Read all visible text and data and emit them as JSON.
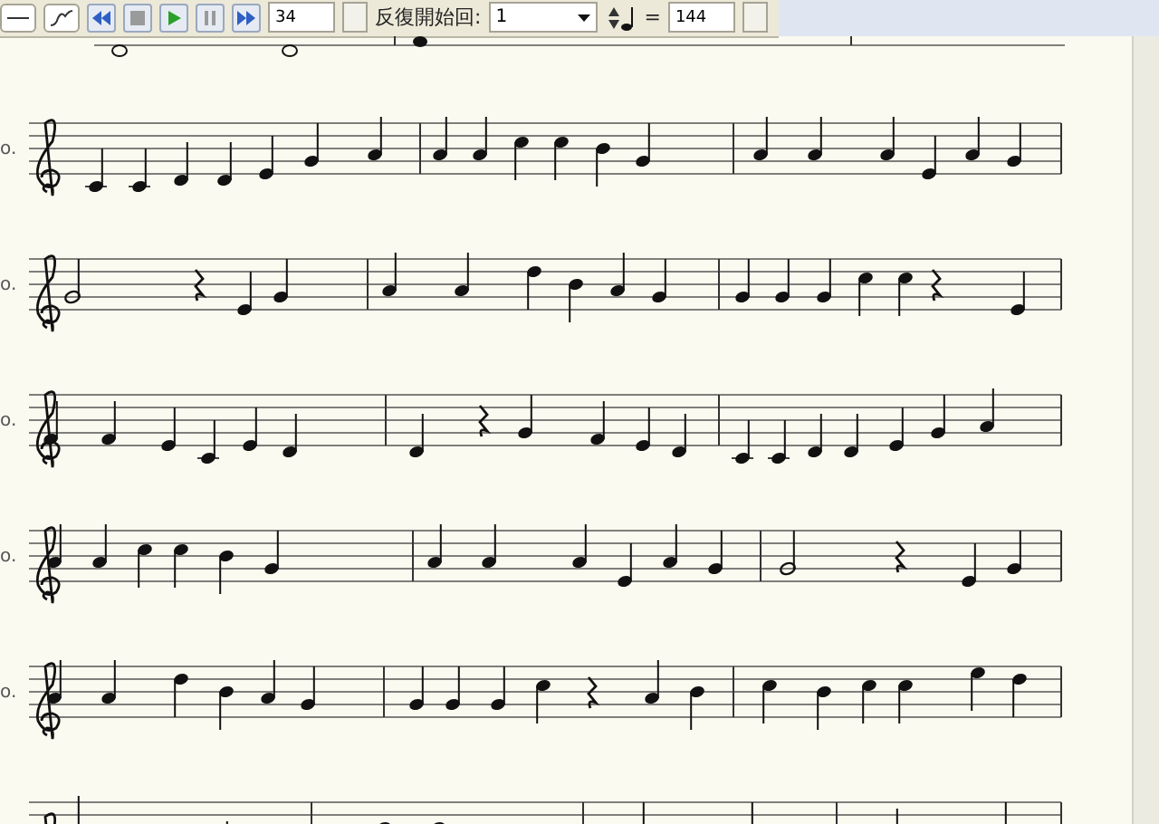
{
  "toolbar": {
    "measure_value": "34",
    "repeat_label": "反復開始回:",
    "repeat_value": "1",
    "tempo_equals": "=",
    "tempo_value": "144"
  },
  "staves": [
    {
      "label": "o."
    },
    {
      "label": "o."
    },
    {
      "label": "o."
    },
    {
      "label": "o."
    },
    {
      "label": "o."
    }
  ]
}
